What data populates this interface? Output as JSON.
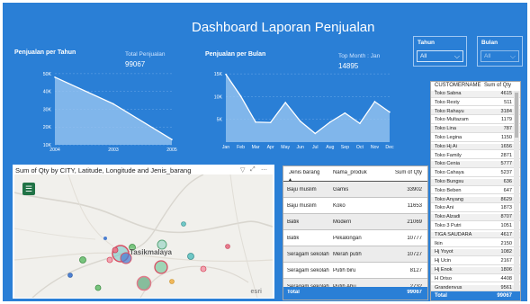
{
  "dashboard_title": "Dashboard Laporan Penjualan",
  "colors": {
    "background": "#2a7fd6",
    "area_fill": "#9dc8f2",
    "line": "#ffffff",
    "total_row": "#2a7fd6",
    "map_menu": "#217346"
  },
  "yearly": {
    "title": "Penjualan per Tahun",
    "kpi_label": "Total Penjualan",
    "kpi_value": "99067",
    "y_ticks": [
      "50K",
      "40K",
      "30K",
      "20K",
      "10K"
    ],
    "x_ticks": [
      "2004",
      "2003",
      "2005"
    ]
  },
  "monthly": {
    "title": "Penjualan per Bulan",
    "kpi_label": "Top Month : Jan",
    "kpi_value": "14895",
    "y_ticks": [
      "15K",
      "10K",
      "5K"
    ]
  },
  "chart_data": [
    {
      "type": "area",
      "title": "Penjualan per Tahun",
      "categories": [
        "2004",
        "2003",
        "2005"
      ],
      "values": [
        48000,
        33000,
        13000
      ],
      "ylim": [
        10000,
        55000
      ],
      "grid": true
    },
    {
      "type": "area",
      "title": "Penjualan per Bulan",
      "categories": [
        "Jan",
        "Feb",
        "Mar",
        "Apr",
        "May",
        "Jun",
        "Jul",
        "Aug",
        "Sep",
        "Oct",
        "Nov",
        "Dec"
      ],
      "values": [
        14895,
        10100,
        4400,
        4300,
        8700,
        4600,
        1900,
        4400,
        6400,
        4100,
        8900,
        6600
      ],
      "ylim": [
        0,
        17000
      ],
      "grid": true
    }
  ],
  "slicers": [
    {
      "title": "Tahun",
      "value": "All",
      "active": true
    },
    {
      "title": "Bulan",
      "value": "All",
      "active": false
    }
  ],
  "map": {
    "title": "Sum of Qty by CITY, Latitude, Longitude and Jenis_barang",
    "city_label": "Tasikmalaya",
    "attribution": "esri",
    "icons": [
      "filter-icon",
      "focus-icon",
      "more-icon"
    ]
  },
  "product_table": {
    "headers": [
      "Jenis barang",
      "Nama_produk",
      "Sum of Qty"
    ],
    "rows": [
      {
        "jenis": "Baju muslim",
        "produk": "Gamis",
        "qty": "33902"
      },
      {
        "jenis": "Baju muslim",
        "produk": "Koko",
        "qty": "11653"
      },
      {
        "jenis": "Batik",
        "produk": "Modern",
        "qty": "21069"
      },
      {
        "jenis": "Batik",
        "produk": "Pekalongan",
        "qty": "10777"
      },
      {
        "jenis": "Seragam sekolah",
        "produk": "Merah putih",
        "qty": "10727"
      },
      {
        "jenis": "Seragam sekolah",
        "produk": "Putih biru",
        "qty": "8127"
      },
      {
        "jenis": "Seragam sekolah",
        "produk": "Putih Abu",
        "qty": "2732"
      }
    ],
    "total_label": "Total",
    "total_value": "99067"
  },
  "customer_table": {
    "headers": [
      "CUSTOMERNAME",
      "Sum of Qty"
    ],
    "rows": [
      {
        "name": "Toko Sabna",
        "qty": "4615"
      },
      {
        "name": "Toko Resty",
        "qty": "511"
      },
      {
        "name": "Toko Rahayu",
        "qty": "3184"
      },
      {
        "name": "Toko Multazam",
        "qty": "1179"
      },
      {
        "name": "Toko Lina",
        "qty": "787"
      },
      {
        "name": "Toko Legina",
        "qty": "1150"
      },
      {
        "name": "Toko Hj Ai",
        "qty": "1656"
      },
      {
        "name": "Toko Family",
        "qty": "2871"
      },
      {
        "name": "Toko Cenia",
        "qty": "5777"
      },
      {
        "name": "Toko Cahaya",
        "qty": "5237"
      },
      {
        "name": "Toko Bungsu",
        "qty": "636"
      },
      {
        "name": "Toko Beben",
        "qty": "647"
      },
      {
        "name": "Toko Anyang",
        "qty": "8629"
      },
      {
        "name": "Toko Ani",
        "qty": "1873"
      },
      {
        "name": "Toko Alzadi",
        "qty": "8707"
      },
      {
        "name": "Toko 3 Putri",
        "qty": "1051"
      },
      {
        "name": "TIGA SAUDARA",
        "qty": "4617"
      },
      {
        "name": "Ikin",
        "qty": "2150"
      },
      {
        "name": "Hj Yoyot",
        "qty": "1082"
      },
      {
        "name": "Hj Ucin",
        "qty": "2167"
      },
      {
        "name": "Hj Enok",
        "qty": "1806"
      },
      {
        "name": "H Oriso",
        "qty": "4408"
      },
      {
        "name": "Grandenvus",
        "qty": "9561"
      }
    ],
    "total_label": "Total",
    "total_value": "99067"
  }
}
